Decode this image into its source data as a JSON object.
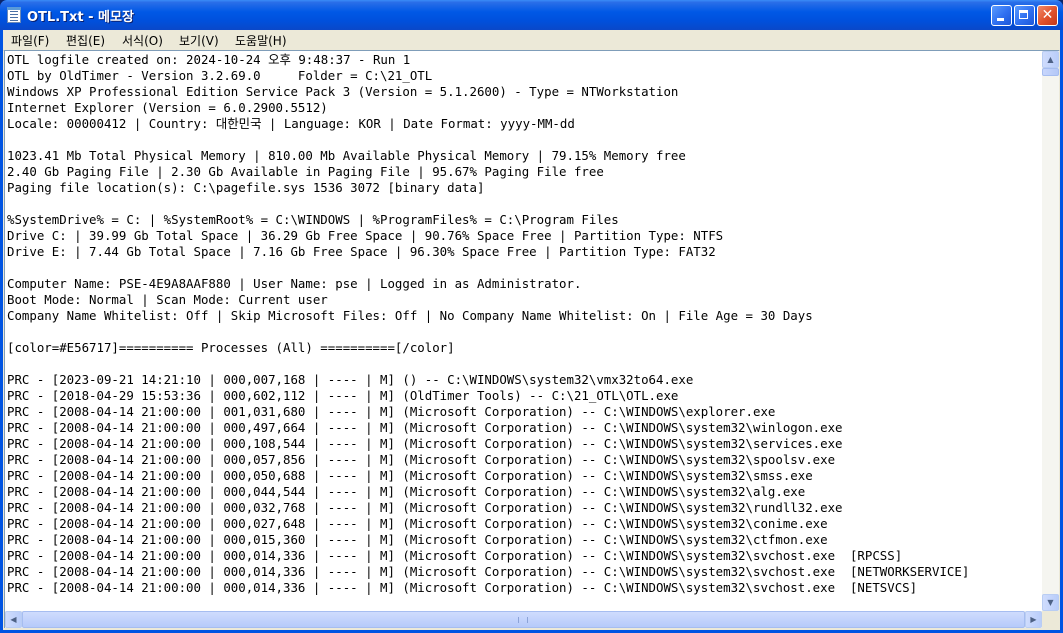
{
  "window": {
    "title": "OTL.Txt - 메모장"
  },
  "menu": [
    "파일(F)",
    "편집(E)",
    "서식(O)",
    "보기(V)",
    "도움말(H)"
  ],
  "lines": [
    "OTL logfile created on: 2024-10-24 오후 9:48:37 - Run 1",
    "OTL by OldTimer - Version 3.2.69.0     Folder = C:\\21_OTL",
    "Windows XP Professional Edition Service Pack 3 (Version = 5.1.2600) - Type = NTWorkstation",
    "Internet Explorer (Version = 6.0.2900.5512)",
    "Locale: 00000412 | Country: 대한민국 | Language: KOR | Date Format: yyyy-MM-dd",
    "",
    "1023.41 Mb Total Physical Memory | 810.00 Mb Available Physical Memory | 79.15% Memory free",
    "2.40 Gb Paging File | 2.30 Gb Available in Paging File | 95.67% Paging File free",
    "Paging file location(s): C:\\pagefile.sys 1536 3072 [binary data]",
    "",
    "%SystemDrive% = C: | %SystemRoot% = C:\\WINDOWS | %ProgramFiles% = C:\\Program Files",
    "Drive C: | 39.99 Gb Total Space | 36.29 Gb Free Space | 90.76% Space Free | Partition Type: NTFS",
    "Drive E: | 7.44 Gb Total Space | 7.16 Gb Free Space | 96.30% Space Free | Partition Type: FAT32",
    "",
    "Computer Name: PSE-4E9A8AAF880 | User Name: pse | Logged in as Administrator.",
    "Boot Mode: Normal | Scan Mode: Current user",
    "Company Name Whitelist: Off | Skip Microsoft Files: Off | No Company Name Whitelist: On | File Age = 30 Days",
    "",
    "[color=#E56717]========== Processes (All) ==========[/color]",
    "",
    "PRC - [2023-09-21 14:21:10 | 000,007,168 | ---- | M] () -- C:\\WINDOWS\\system32\\vmx32to64.exe",
    "PRC - [2018-04-29 15:53:36 | 000,602,112 | ---- | M] (OldTimer Tools) -- C:\\21_OTL\\OTL.exe",
    "PRC - [2008-04-14 21:00:00 | 001,031,680 | ---- | M] (Microsoft Corporation) -- C:\\WINDOWS\\explorer.exe",
    "PRC - [2008-04-14 21:00:00 | 000,497,664 | ---- | M] (Microsoft Corporation) -- C:\\WINDOWS\\system32\\winlogon.exe",
    "PRC - [2008-04-14 21:00:00 | 000,108,544 | ---- | M] (Microsoft Corporation) -- C:\\WINDOWS\\system32\\services.exe",
    "PRC - [2008-04-14 21:00:00 | 000,057,856 | ---- | M] (Microsoft Corporation) -- C:\\WINDOWS\\system32\\spoolsv.exe",
    "PRC - [2008-04-14 21:00:00 | 000,050,688 | ---- | M] (Microsoft Corporation) -- C:\\WINDOWS\\system32\\smss.exe",
    "PRC - [2008-04-14 21:00:00 | 000,044,544 | ---- | M] (Microsoft Corporation) -- C:\\WINDOWS\\system32\\alg.exe",
    "PRC - [2008-04-14 21:00:00 | 000,032,768 | ---- | M] (Microsoft Corporation) -- C:\\WINDOWS\\system32\\rundll32.exe",
    "PRC - [2008-04-14 21:00:00 | 000,027,648 | ---- | M] (Microsoft Corporation) -- C:\\WINDOWS\\system32\\conime.exe",
    "PRC - [2008-04-14 21:00:00 | 000,015,360 | ---- | M] (Microsoft Corporation) -- C:\\WINDOWS\\system32\\ctfmon.exe",
    "PRC - [2008-04-14 21:00:00 | 000,014,336 | ---- | M] (Microsoft Corporation) -- C:\\WINDOWS\\system32\\svchost.exe  [RPCSS]",
    "PRC - [2008-04-14 21:00:00 | 000,014,336 | ---- | M] (Microsoft Corporation) -- C:\\WINDOWS\\system32\\svchost.exe  [NETWORKSERVICE]",
    "PRC - [2008-04-14 21:00:00 | 000,014,336 | ---- | M] (Microsoft Corporation) -- C:\\WINDOWS\\system32\\svchost.exe  [NETSVCS]"
  ]
}
